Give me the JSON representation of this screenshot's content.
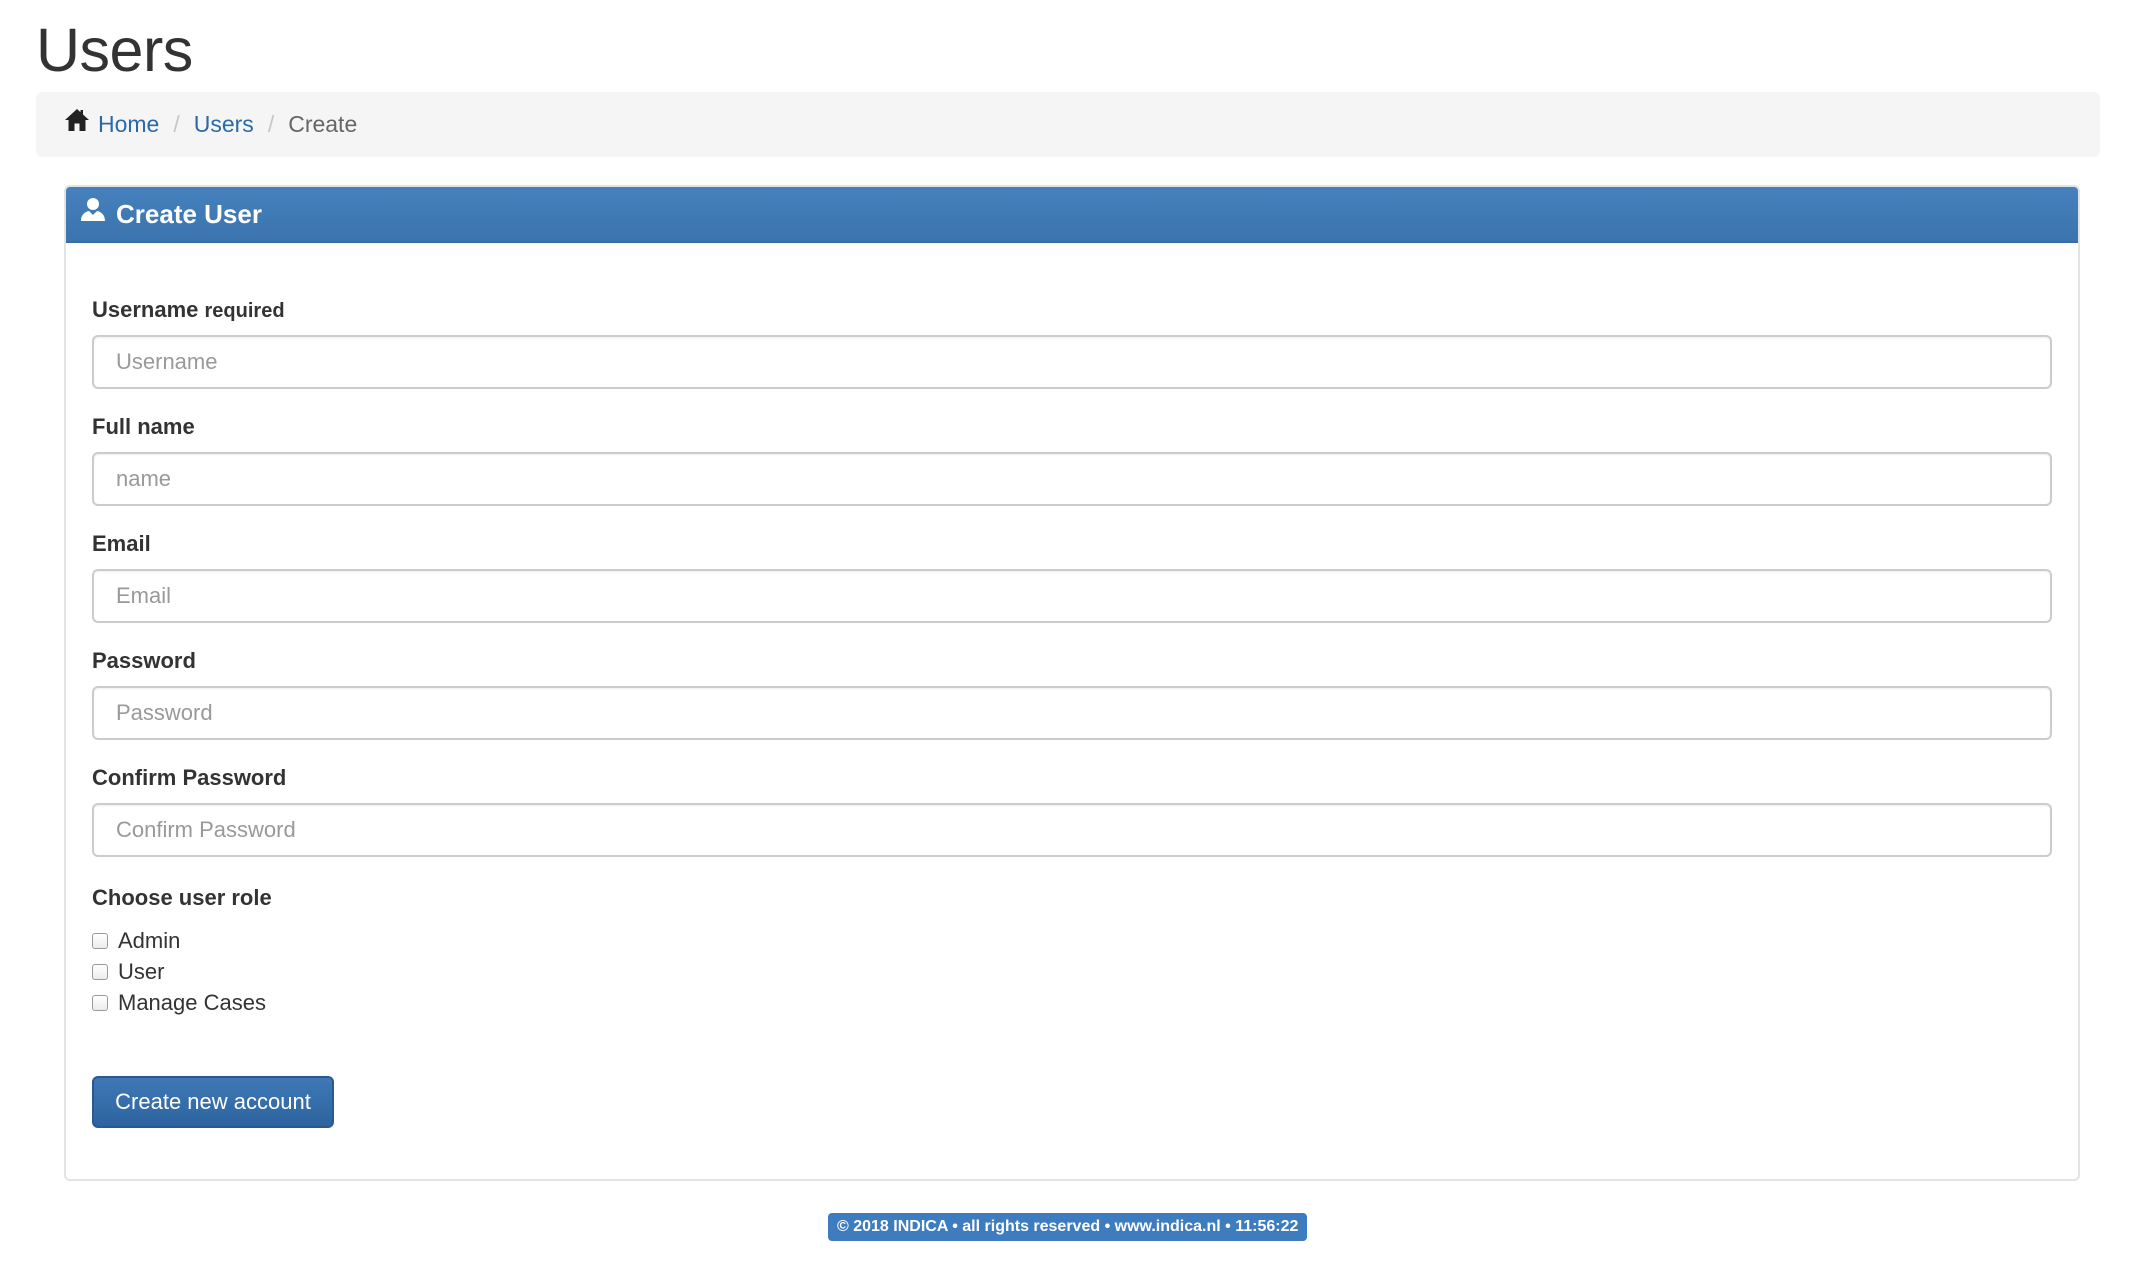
{
  "page": {
    "title": "Users"
  },
  "breadcrumb": {
    "home_label": "Home",
    "users_label": "Users",
    "current_label": "Create",
    "separator": "/"
  },
  "panel": {
    "title": "Create User",
    "icon": "user-icon"
  },
  "form": {
    "username": {
      "label": "Username",
      "hint": "required",
      "placeholder": "Username",
      "value": ""
    },
    "fullname": {
      "label": "Full name",
      "placeholder": "name",
      "value": ""
    },
    "email": {
      "label": "Email",
      "placeholder": "Email",
      "value": ""
    },
    "password": {
      "label": "Password",
      "placeholder": "Password",
      "value": ""
    },
    "confirm_password": {
      "label": "Confirm Password",
      "placeholder": "Confirm Password",
      "value": ""
    },
    "roles": {
      "label": "Choose user role",
      "options": [
        {
          "label": "Admin",
          "checked": false
        },
        {
          "label": "User",
          "checked": false
        },
        {
          "label": "Manage Cases",
          "checked": false
        }
      ]
    },
    "submit_label": "Create new account"
  },
  "footer": {
    "text": "© 2018 INDICA • all rights reserved • www.indica.nl • 11:56:22"
  },
  "colors": {
    "accent": "#3e7cc0",
    "link": "#2a6aa8",
    "panel_header": "#4581bd"
  }
}
